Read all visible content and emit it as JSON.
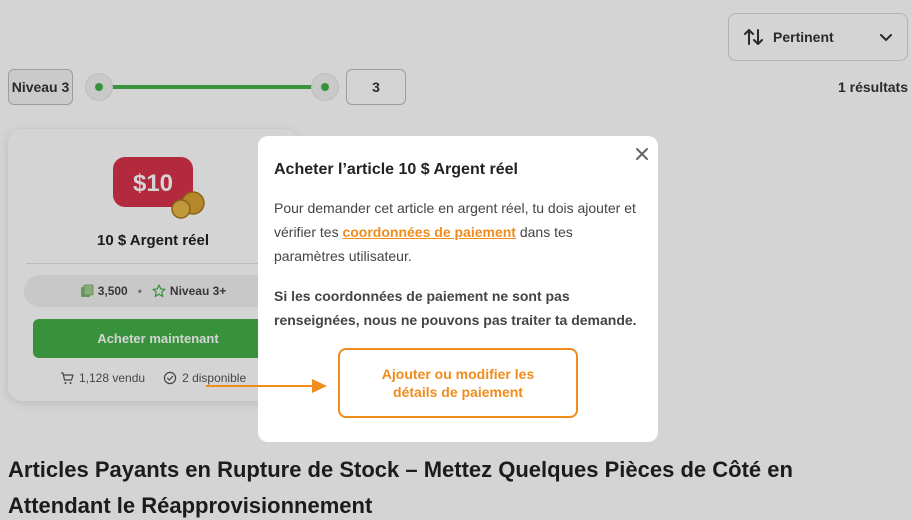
{
  "sort": {
    "label": "Pertinent",
    "icon": "sort-arrows-icon"
  },
  "filter": {
    "level_tag": "Niveau 3",
    "level_value": "3",
    "slider_min": 3,
    "slider_max": 3
  },
  "results": {
    "count_label": "1 résultats"
  },
  "card": {
    "price_logo": "$10",
    "title": "10 $ Argent réel",
    "cost": "3,500",
    "level": "Niveau 3+",
    "buy_label": "Acheter maintenant",
    "sold": "1,128 vendu",
    "available": "2 disponible"
  },
  "section": {
    "heading": "Articles Payants en Rupture de Stock – Mettez Quelques Pièces de Côté en Attendant le Réapprovisionnement"
  },
  "modal": {
    "title": "Acheter l’article 10 $ Argent réel",
    "body_before": "Pour demander cet article en argent réel, tu dois ajouter et vérifier tes ",
    "body_link": "coordonnées de paiement",
    "body_after": " dans tes paramètres utilisateur.",
    "warning": "Si les coordonnées de paiement ne sont pas renseignées, nous ne pouvons pas traiter ta demande.",
    "action_label": "Ajouter ou modifier les détails de paiement"
  },
  "colors": {
    "accent": "#43b047",
    "orange": "#f08c1b",
    "logo_red": "#d8324a"
  }
}
